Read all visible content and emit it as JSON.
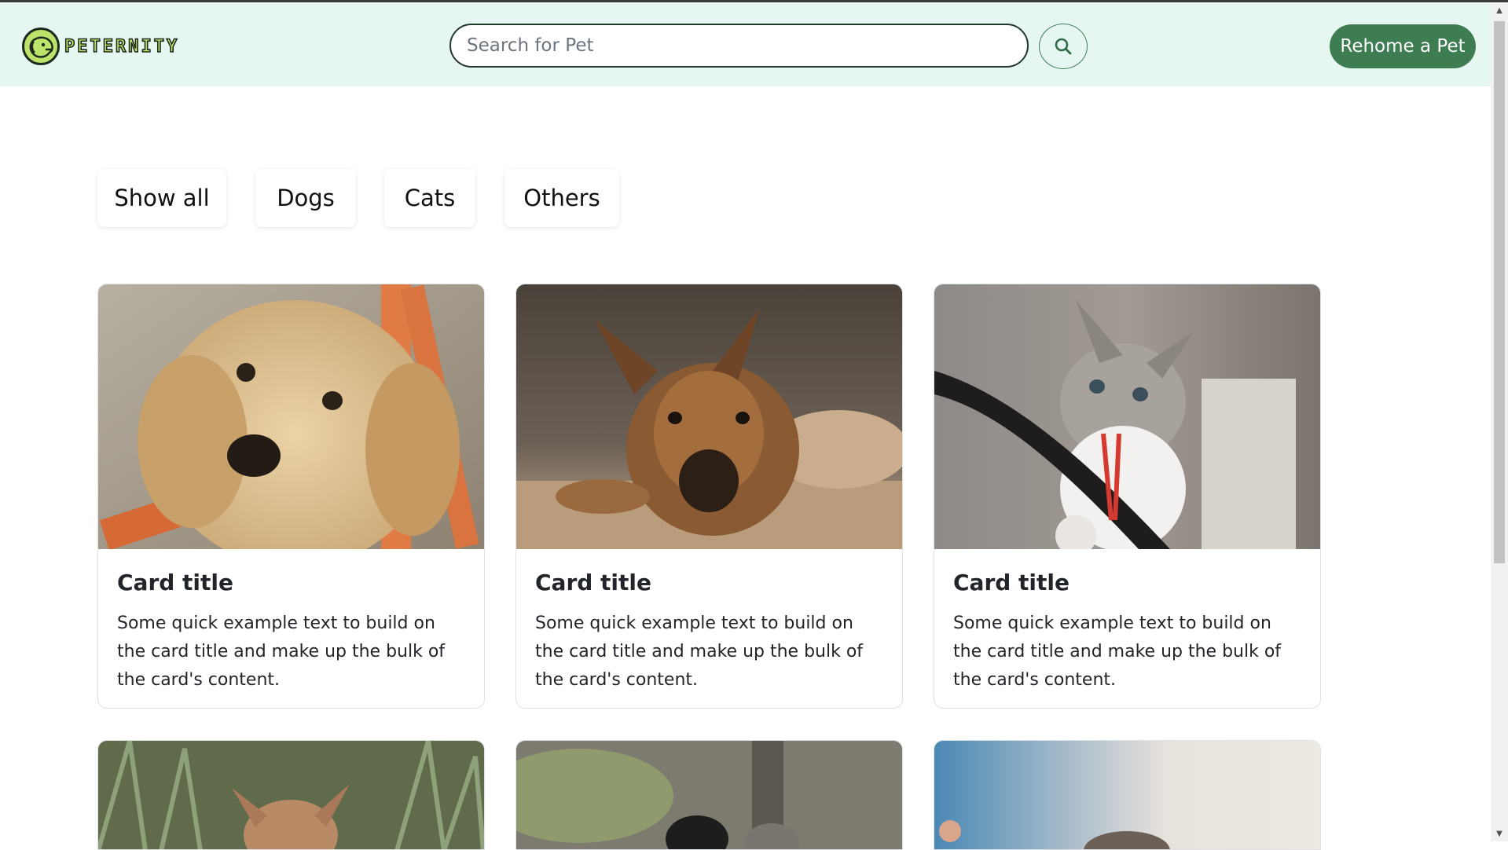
{
  "header": {
    "brand": "PETERNITY",
    "search_placeholder": "Search for Pet",
    "search_value": "",
    "rehome_label": "Rehome a Pet"
  },
  "filters": [
    {
      "label": "Show all"
    },
    {
      "label": "Dogs"
    },
    {
      "label": "Cats"
    },
    {
      "label": "Others"
    }
  ],
  "cards": [
    {
      "title": "Card title",
      "text": "Some quick example text to build on the card title and make up the bulk of the card's content.",
      "image": "golden-retriever-puppy"
    },
    {
      "title": "Card title",
      "text": "Some quick example text to build on the card title and make up the bulk of the card's content.",
      "image": "brown-dog-lying"
    },
    {
      "title": "Card title",
      "text": "Some quick example text to build on the card title and make up the bulk of the card's content.",
      "image": "tabby-kitten-with-toy"
    }
  ],
  "partial_cards": [
    {
      "image": "dog-in-grass"
    },
    {
      "image": "kittens-outdoors"
    },
    {
      "image": "cat-blurred"
    }
  ],
  "colors": {
    "header_bg": "#e6f6f1",
    "accent_green": "#3d7d51",
    "logo_lime": "#c9ec6c"
  }
}
